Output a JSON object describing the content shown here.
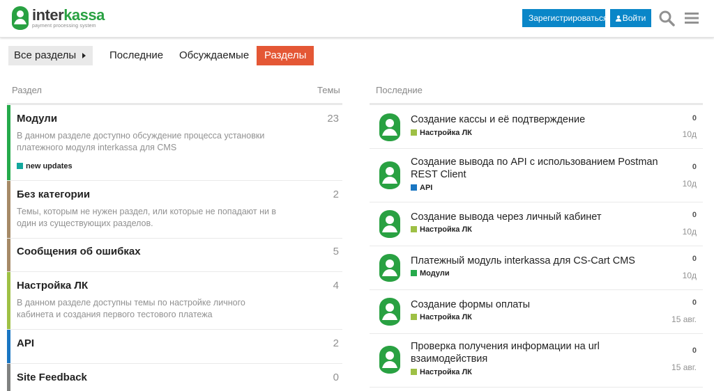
{
  "header": {
    "logo_name_a": "inter",
    "logo_name_b": "kassa",
    "logo_sub": "payment processing system",
    "signup_label": "Зарегистрироваться",
    "login_label": "Войти"
  },
  "nav": {
    "all_categories": "Все разделы",
    "latest": "Последние",
    "top": "Обсуждаемые",
    "categories": "Разделы"
  },
  "categories": {
    "col_category": "Раздел",
    "col_topics": "Темы",
    "items": [
      {
        "title": "Модули",
        "count": "23",
        "desc": "В данном разделе доступно обсуждение процесса установки платежного модуля interkassa для CMS",
        "subcategory": "new updates",
        "color": "#25aa4b"
      },
      {
        "title": "Без категории",
        "count": "2",
        "desc": "Темы, которым не нужен раздел, или которые не попадают ни в один из существующих разделов.",
        "color": "#a68a67"
      },
      {
        "title": "Сообщения об ошибках",
        "count": "5",
        "color": "#a68a67"
      },
      {
        "title": "Настройка ЛК",
        "count": "4",
        "desc": "В данном разделе доступны темы по настройке личного кабинета и создания первого тестового платежа",
        "color": "#9ec045"
      },
      {
        "title": "API",
        "count": "2",
        "color": "#1a76c2"
      },
      {
        "title": "Site Feedback",
        "count": "0",
        "color": "#808281"
      }
    ]
  },
  "latest": {
    "heading": "Последние",
    "topics": [
      {
        "title": "Создание кассы и её подтверждение",
        "category": "Настройка ЛК",
        "cat_color": "#9ec045",
        "posts": "0",
        "age": "10д"
      },
      {
        "title": "Создание вывода по API с использованием Postman REST Client",
        "category": "API",
        "cat_color": "#1a76c2",
        "posts": "0",
        "age": "10д"
      },
      {
        "title": "Создание вывода через личный кабинет",
        "category": "Настройка ЛК",
        "cat_color": "#9ec045",
        "posts": "0",
        "age": "10д"
      },
      {
        "title": "Платежный модуль interkassa для CS-Cart CMS",
        "category": "Модули",
        "cat_color": "#25aa4b",
        "posts": "0",
        "age": "10д"
      },
      {
        "title": "Создание формы оплаты",
        "category": "Настройка ЛК",
        "cat_color": "#9ec045",
        "posts": "0",
        "age": "15 авг."
      },
      {
        "title": "Проверка получения информации на url взаимодействия",
        "category": "Настройка ЛК",
        "cat_color": "#9ec045",
        "posts": "0",
        "age": "15 авг."
      }
    ]
  },
  "colors": {
    "accent": "#e45735",
    "primary_button": "#0a86c8",
    "brand_green": "#29a142"
  }
}
